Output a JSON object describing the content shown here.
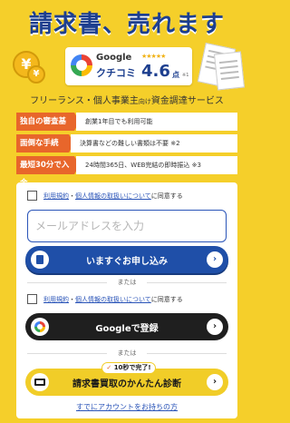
{
  "headline": "請求書、売れます",
  "rating": {
    "google": "Google",
    "stars": "★★★★★",
    "kuchikomi": "クチコミ",
    "score": "4.6",
    "unit": "点",
    "note": "※1"
  },
  "hero": {
    "coin_symbol": "¥"
  },
  "subtitle": {
    "before": "フリーランス・個人事業主",
    "small": "向け",
    "after": "資金調達サービス"
  },
  "features": [
    {
      "badge": "独自の審査基準",
      "text": "創業1年目でも利用可能"
    },
    {
      "badge": "面倒な手続き",
      "text": "決算書などの難しい書類は不要 ※2"
    },
    {
      "badge": "最短30分で入金",
      "text": "24時間365日、WEB完結の即時振込 ※3"
    }
  ],
  "form": {
    "agree1": {
      "link1": "利用規約",
      "sep": "・",
      "link2": "個人情報の取扱いについて",
      "tail": "に同意する"
    },
    "email_placeholder": "メールアドレスを入力",
    "apply_label": "いますぐお申し込み",
    "or1": "または",
    "agree2": {
      "link1": "利用規約",
      "sep": "・",
      "link2": "個人情報の取扱いについて",
      "tail": "に同意する"
    },
    "google_label": "Googleで登録",
    "or2": "または",
    "diag_badge": "10秒で完了!",
    "diag_badge_icon": "✓",
    "diag_label": "請求書買取のかんたん診断",
    "login_link": "すでにアカウントをお持ちの方",
    "arrow": "›"
  },
  "colors": {
    "background": "#f5cf2a",
    "primary": "#1f4fa8",
    "badge": "#e8662b",
    "google_btn": "#1f1f1f"
  }
}
